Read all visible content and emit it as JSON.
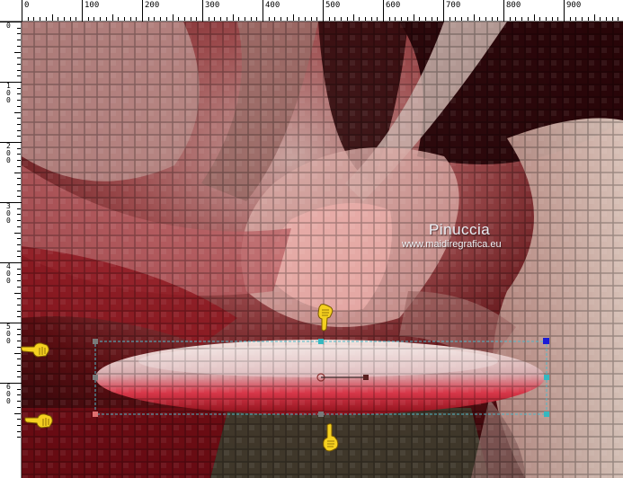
{
  "ruler": {
    "horizontal_labels": [
      "0",
      "100",
      "200",
      "300",
      "400",
      "500",
      "600",
      "700",
      "800",
      "900"
    ],
    "vertical_labels": [
      "0",
      "1\n0\n0",
      "2\n0\n0",
      "3\n0\n0",
      "4\n0\n0",
      "5\n0\n0",
      "6\n0\n0"
    ]
  },
  "watermark": {
    "title": "Pinuccia",
    "url": "www.maidiregrafica.eu"
  },
  "colors": {
    "ruler_bg": "#ffffff",
    "frame_bg": "#d4d0c8",
    "selection_line": "#4fb8c8",
    "handle_fill": "#35b8c0",
    "hand_fill": "#f5d020"
  },
  "icons": [
    "pointing-hand-down-icon",
    "pointing-hand-right-icon",
    "pointing-hand-right-icon",
    "pointing-hand-up-icon"
  ]
}
